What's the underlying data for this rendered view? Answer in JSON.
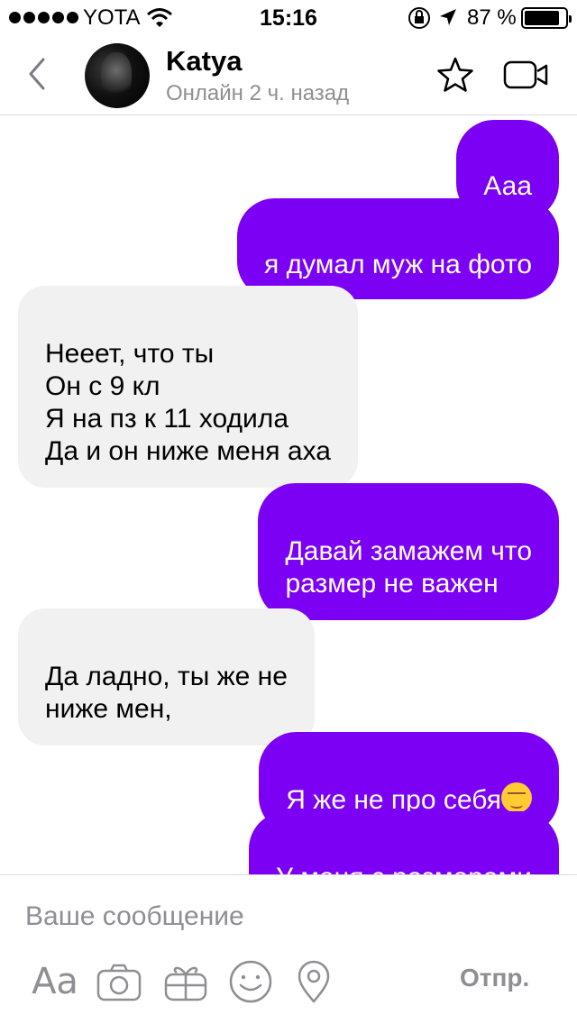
{
  "status_bar": {
    "carrier": "YOTA",
    "time": "15:16",
    "battery": "87 %",
    "battery_level": 0.87
  },
  "header": {
    "name": "Katya",
    "status": "Онлайн 2 ч. назад"
  },
  "messages": [
    {
      "direction": "outgoing",
      "text": "Ааа"
    },
    {
      "direction": "outgoing",
      "text": "я думал муж на фото"
    },
    {
      "direction": "incoming",
      "text": "Нееет, что ты\nОн с 9 кл\nЯ на пз к 11 ходила\nДа и он ниже меня аха"
    },
    {
      "direction": "outgoing",
      "text": "Давай замажем что\nразмер не важен"
    },
    {
      "direction": "incoming",
      "text": "Да ладно, ты же не\nниже мен,"
    },
    {
      "direction": "outgoing",
      "text": "Я же не про себя",
      "emoji": "smirk-emoji"
    },
    {
      "direction": "outgoing",
      "text": "У меня с размерами",
      "emoji": "smirk-emoji"
    }
  ],
  "composer": {
    "placeholder": "Ваше сообщение",
    "font_label": "Aa",
    "send_label": "Отпр."
  },
  "icons": {
    "back": "chevron-left-icon",
    "star": "star-icon",
    "video": "video-camera-icon",
    "camera": "camera-icon",
    "gift": "gift-icon",
    "smile": "smile-icon",
    "location": "location-pin-icon"
  },
  "colors": {
    "accent": "#7b00f4",
    "incoming_bubble": "#f1f1f2",
    "muted": "#8e8e93"
  }
}
